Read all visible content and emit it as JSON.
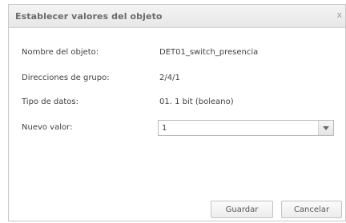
{
  "dialog": {
    "title": "Establecer valores del objeto",
    "close_label": "x"
  },
  "fields": {
    "object_name_label": "Nombre del objeto:",
    "object_name_value": "DET01_switch_presencia",
    "group_address_label": "Direcciones de grupo:",
    "group_address_value": "2/4/1",
    "data_type_label": "Tipo de datos:",
    "data_type_value": "01. 1 bit (boleano)",
    "new_value_label": "Nuevo valor:",
    "new_value_selected": "1"
  },
  "buttons": {
    "save_label": "Guardar",
    "cancel_label": "Cancelar"
  },
  "icons": {
    "dropdown": "chevron-down-icon",
    "close": "close-icon"
  }
}
